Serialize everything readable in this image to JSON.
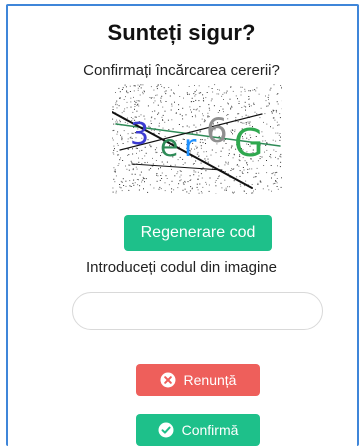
{
  "dialog": {
    "title": "Sunteți sigur?",
    "subtitle": "Confirmați încărcarea cererii?"
  },
  "captcha": {
    "characters": [
      "3",
      "e",
      "r",
      "6",
      "G"
    ],
    "colors": {
      "3": "#3b3bd1",
      "e": "#2e8b57",
      "r": "#1e90ff",
      "6": "#8f8f8f",
      "G": "#2fa84f"
    }
  },
  "buttons": {
    "regenerate": "Regenerare cod",
    "cancel": "Renunță",
    "confirm": "Confirmă"
  },
  "code_field": {
    "label": "Introduceți codul din imagine",
    "value": "",
    "placeholder": ""
  },
  "colors": {
    "accent_green": "#1ec08a",
    "danger_red": "#ee5f5b",
    "frame_blue": "#3f86d9"
  },
  "icons": {
    "cancel": "close-circle-icon",
    "confirm": "check-circle-icon"
  }
}
